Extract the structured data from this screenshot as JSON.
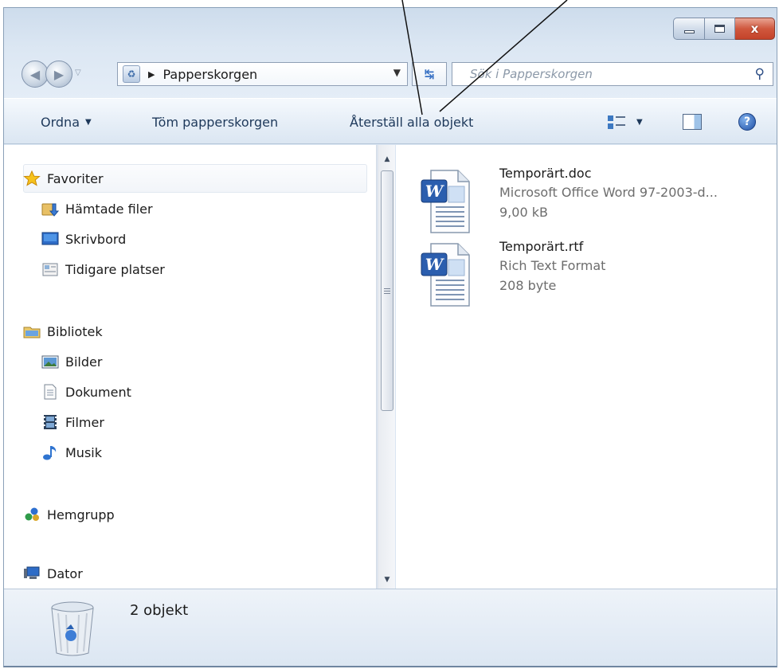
{
  "window": {
    "caption": {
      "minimize": "–",
      "maximize": "□",
      "close": "x"
    }
  },
  "navigation": {
    "address_path": "Papperskorgen",
    "search_placeholder": "Sök i Papperskorgen",
    "back_glyph": "◀",
    "forward_glyph": "▶"
  },
  "toolbar": {
    "organize_label": "Ordna",
    "empty_label": "Töm papperskorgen",
    "restore_label": "Återställ alla objekt"
  },
  "nav_pane": {
    "favorites": {
      "label": "Favoriter",
      "icon": "star-icon"
    },
    "favorite_items": [
      {
        "label": "Hämtade filer",
        "icon": "downloads-folder-icon"
      },
      {
        "label": "Skrivbord",
        "icon": "desktop-icon"
      },
      {
        "label": "Tidigare platser",
        "icon": "recent-places-icon"
      }
    ],
    "libraries": {
      "label": "Bibliotek",
      "icon": "library-icon"
    },
    "library_items": [
      {
        "label": "Bilder",
        "icon": "pictures-icon"
      },
      {
        "label": "Dokument",
        "icon": "documents-icon"
      },
      {
        "label": "Filmer",
        "icon": "videos-icon"
      },
      {
        "label": "Musik",
        "icon": "music-icon"
      }
    ],
    "homegroup": {
      "label": "Hemgrupp",
      "icon": "homegroup-icon"
    },
    "computer": {
      "label": "Dator",
      "icon": "computer-icon"
    }
  },
  "files": [
    {
      "name": "Temporärt.doc",
      "type": "Microsoft Office Word 97-2003-d...",
      "size": "9,00 kB",
      "icon": "word-document-icon"
    },
    {
      "name": "Temporärt.rtf",
      "type": "Rich Text Format",
      "size": "208 byte",
      "icon": "word-document-icon"
    }
  ],
  "details": {
    "count": "2 objekt",
    "icon": "recycle-bin-icon"
  },
  "colors": {
    "accent": "#1e395b",
    "close_button": "#c4432a"
  }
}
